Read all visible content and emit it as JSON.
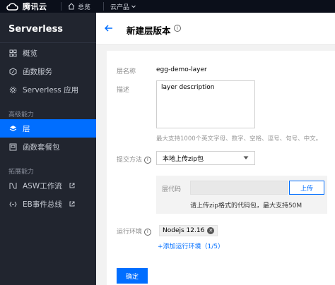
{
  "topbar": {
    "brand": "腾讯云",
    "home": "总览",
    "products": "云产品"
  },
  "sidebar": {
    "title": "Serverless",
    "items": [
      {
        "label": "概览",
        "icon": "grid-icon"
      },
      {
        "label": "函数服务",
        "icon": "hexagon-icon"
      },
      {
        "label": "Serverless 应用",
        "icon": "gear-icon"
      }
    ],
    "group1": "高级能力",
    "active_item": {
      "label": "层",
      "icon": "layers-icon"
    },
    "items2": [
      {
        "label": "函数套餐包",
        "icon": "package-icon"
      }
    ],
    "group2": "拓展能力",
    "items3": [
      {
        "label": "ASW工作流",
        "icon": "workflow-icon"
      },
      {
        "label": "EB事件总线",
        "icon": "event-bus-icon"
      }
    ]
  },
  "header": {
    "title": "新建层版本"
  },
  "form": {
    "layer_name_label": "层名称",
    "layer_name_value": "egg-demo-layer",
    "description_label": "描述",
    "description_value": "layer description",
    "description_hint": "最大支持1000个英文字母、数字、空格、逗号、句号、中文。",
    "submit_method_label": "提交方法",
    "submit_method_value": "本地上传zip包",
    "code_label": "层代码",
    "upload_button": "上传",
    "upload_hint": "请上传zip格式的代码包，最大支持50M",
    "runtime_label": "运行环境",
    "runtime_tag": "Nodejs 12.16",
    "add_runtime": "+添加运行环境（1/5）",
    "confirm_button": "确定"
  },
  "colors": {
    "accent": "#006eff",
    "sidebar_bg": "#21252f",
    "topbar_bg": "#0b0f1a"
  }
}
